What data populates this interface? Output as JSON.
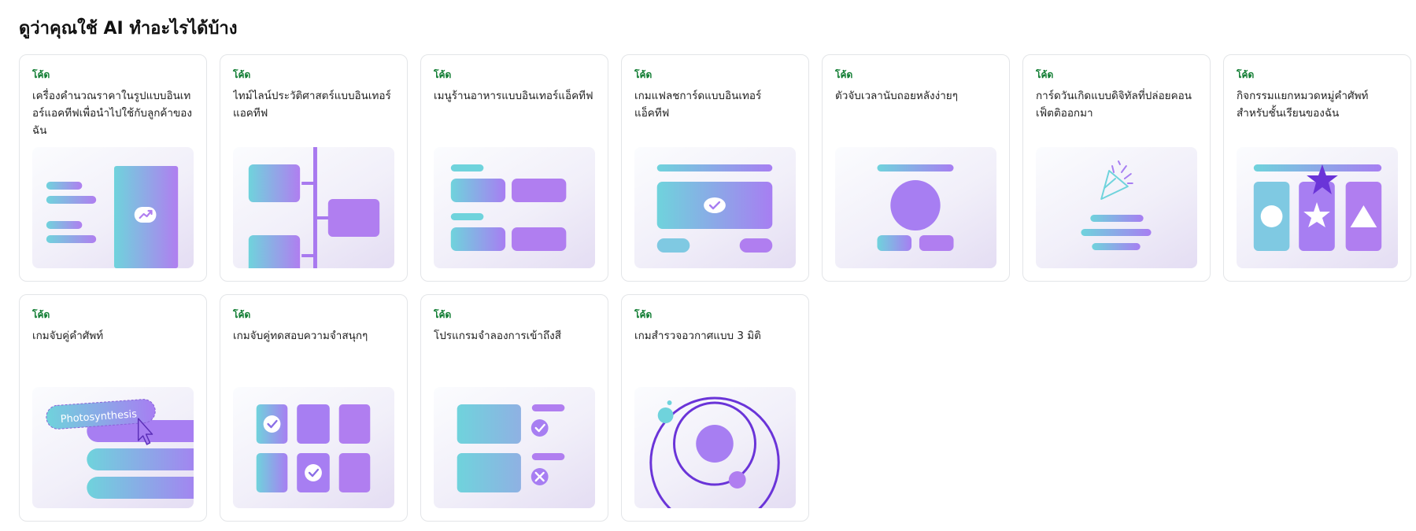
{
  "heading": "ดูว่าคุณใช้ AI ทำอะไรได้บ้าง",
  "colors": {
    "tag": "#0b7a2e",
    "teal": "#6fd3dc",
    "purple": "#b07ef0",
    "deep_purple": "#6a34d8"
  },
  "cards": [
    {
      "tag": "โค้ด",
      "title": "เครื่องคำนวณราคาในรูปแบบอินเทอร์แอคทีฟเพื่อนำไปใช้กับลูกค้าของฉัน",
      "icon": "trend-up-icon"
    },
    {
      "tag": "โค้ด",
      "title": "ไทม์ไลน์ประวัติศาสตร์แบบอินเทอร์แอคทีฟ",
      "icon": "timeline-illustration"
    },
    {
      "tag": "โค้ด",
      "title": "เมนูร้านอาหารแบบอินเทอร์แอ็คทีฟ",
      "icon": "menu-illustration"
    },
    {
      "tag": "โค้ด",
      "title": "เกมแฟลชการ์ดแบบอินเทอร์แอ็คทีฟ",
      "icon": "check-icon"
    },
    {
      "tag": "โค้ด",
      "title": "ตัวจับเวลานับถอยหลังง่ายๆ",
      "icon": "timer-illustration"
    },
    {
      "tag": "โค้ด",
      "title": "การ์ดวันเกิดแบบดิจิทัลที่ปล่อยคอนเฟ็ตติออกมา",
      "icon": "party-popper-icon"
    },
    {
      "tag": "โค้ด",
      "title": "กิจกรรมแยกหมวดหมู่คำศัพท์สำหรับชั้นเรียนของฉัน",
      "icon": "shapes-illustration"
    },
    {
      "tag": "โค้ด",
      "title": "เกมจับคู่คำศัพท์",
      "icon": "cursor-icon",
      "thumb_word": "Photosynthesis"
    },
    {
      "tag": "โค้ด",
      "title": "เกมจับคู่ทดสอบความจำสนุกๆ",
      "icon": "memory-grid-illustration"
    },
    {
      "tag": "โค้ด",
      "title": "โปรแกรมจำลองการเข้าถึงสี",
      "icon": "checklist-illustration"
    },
    {
      "tag": "โค้ด",
      "title": "เกมสำรวจอวกาศแบบ 3 มิติ",
      "icon": "orbit-illustration"
    }
  ]
}
